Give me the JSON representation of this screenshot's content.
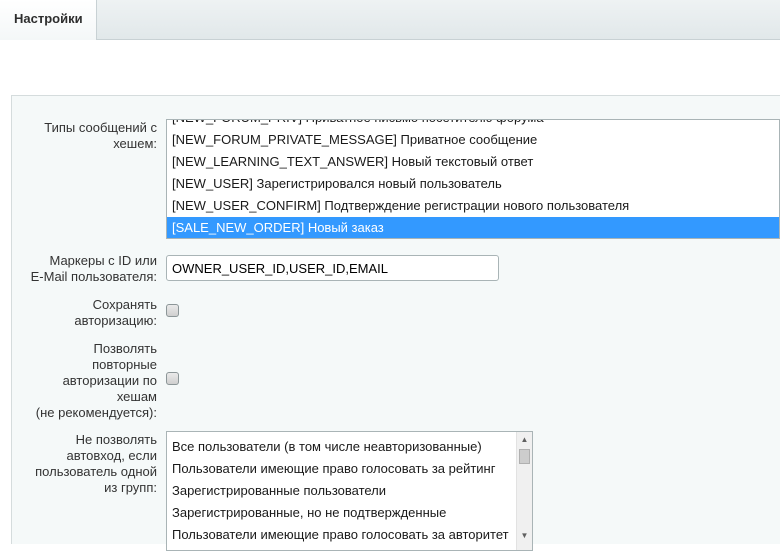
{
  "tabs": [
    {
      "label": "Настройки"
    }
  ],
  "fields": {
    "message_types": {
      "label": "Типы сообщений с\nхешем:",
      "options": [
        "[NEW_FORUM_PRIV] Приватное письмо посетителю форума",
        "[NEW_FORUM_PRIVATE_MESSAGE] Приватное сообщение",
        "[NEW_LEARNING_TEXT_ANSWER] Новый текстовый ответ",
        "[NEW_USER] Зарегистрировался новый пользователь",
        "[NEW_USER_CONFIRM] Подтверждение регистрации нового пользователя",
        "[SALE_NEW_ORDER] Новый заказ"
      ],
      "selected": "[SALE_NEW_ORDER] Новый заказ"
    },
    "markers": {
      "label": "Маркеры с ID или\nE-Mail пользователя:",
      "value": "OWNER_USER_ID,USER_ID,EMAIL"
    },
    "save_auth": {
      "label": "Сохранять\nавторизацию:",
      "checked": false
    },
    "allow_repeat": {
      "label": "Позволять\nповторные\nавторизации по\nхешам\n(не рекомендуется):",
      "checked": false
    },
    "deny_groups": {
      "label": "Не позволять\nавтовход, если\nпользователь одной\nиз групп:",
      "options": [
        "Все пользователи (в том числе неавторизованные)",
        "Пользователи имеющие право голосовать за рейтинг",
        "Зарегистрированные пользователи",
        "Зарегистрированные, но не подтвержденные",
        "Пользователи имеющие право голосовать за авторитет"
      ]
    }
  },
  "colors": {
    "selection": "#3399ff",
    "panel": "#f5f9f9"
  },
  "icons": {
    "scroll_up": "scroll-up-arrow-icon",
    "scroll_down": "scroll-down-arrow-icon"
  }
}
